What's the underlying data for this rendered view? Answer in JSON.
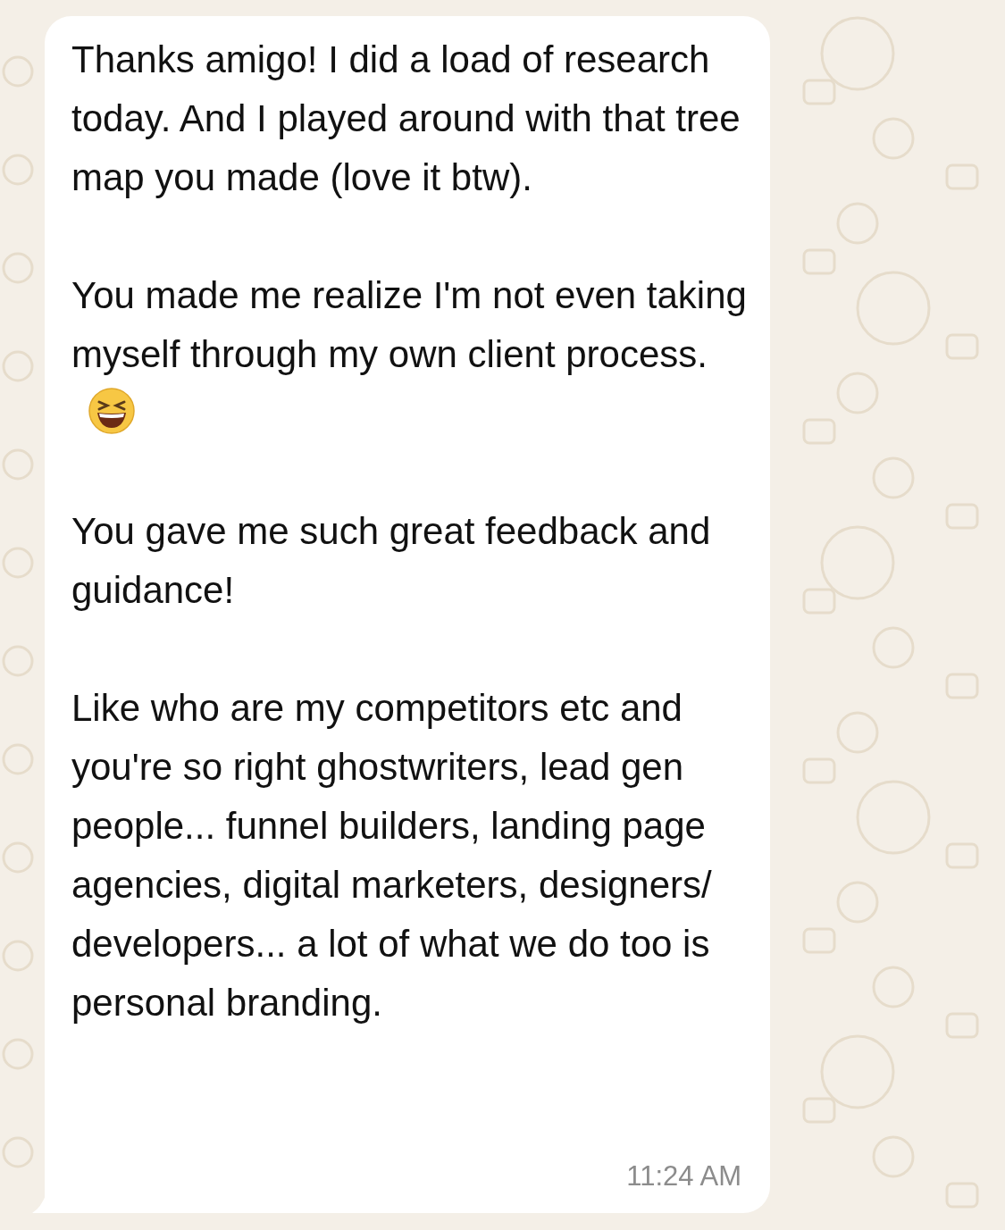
{
  "message": {
    "paragraphs": [
      {
        "kind": "text",
        "text": "Thanks amigo! I did a load of research today. And I played around with that tree map you made (love it btw)."
      },
      {
        "kind": "text_with_emoji",
        "text": "You made me realize I'm not even taking myself through my own client process."
      },
      {
        "kind": "text",
        "text": "You gave me such great feedback and guidance!"
      },
      {
        "kind": "text",
        "text": "Like who are my competitors etc and you're so right ghostwriters, lead gen people... funnel builders, landing page agencies, digital marketers, designers/ developers...  a lot of what we do too is personal branding."
      }
    ],
    "time": "11:24 AM"
  }
}
